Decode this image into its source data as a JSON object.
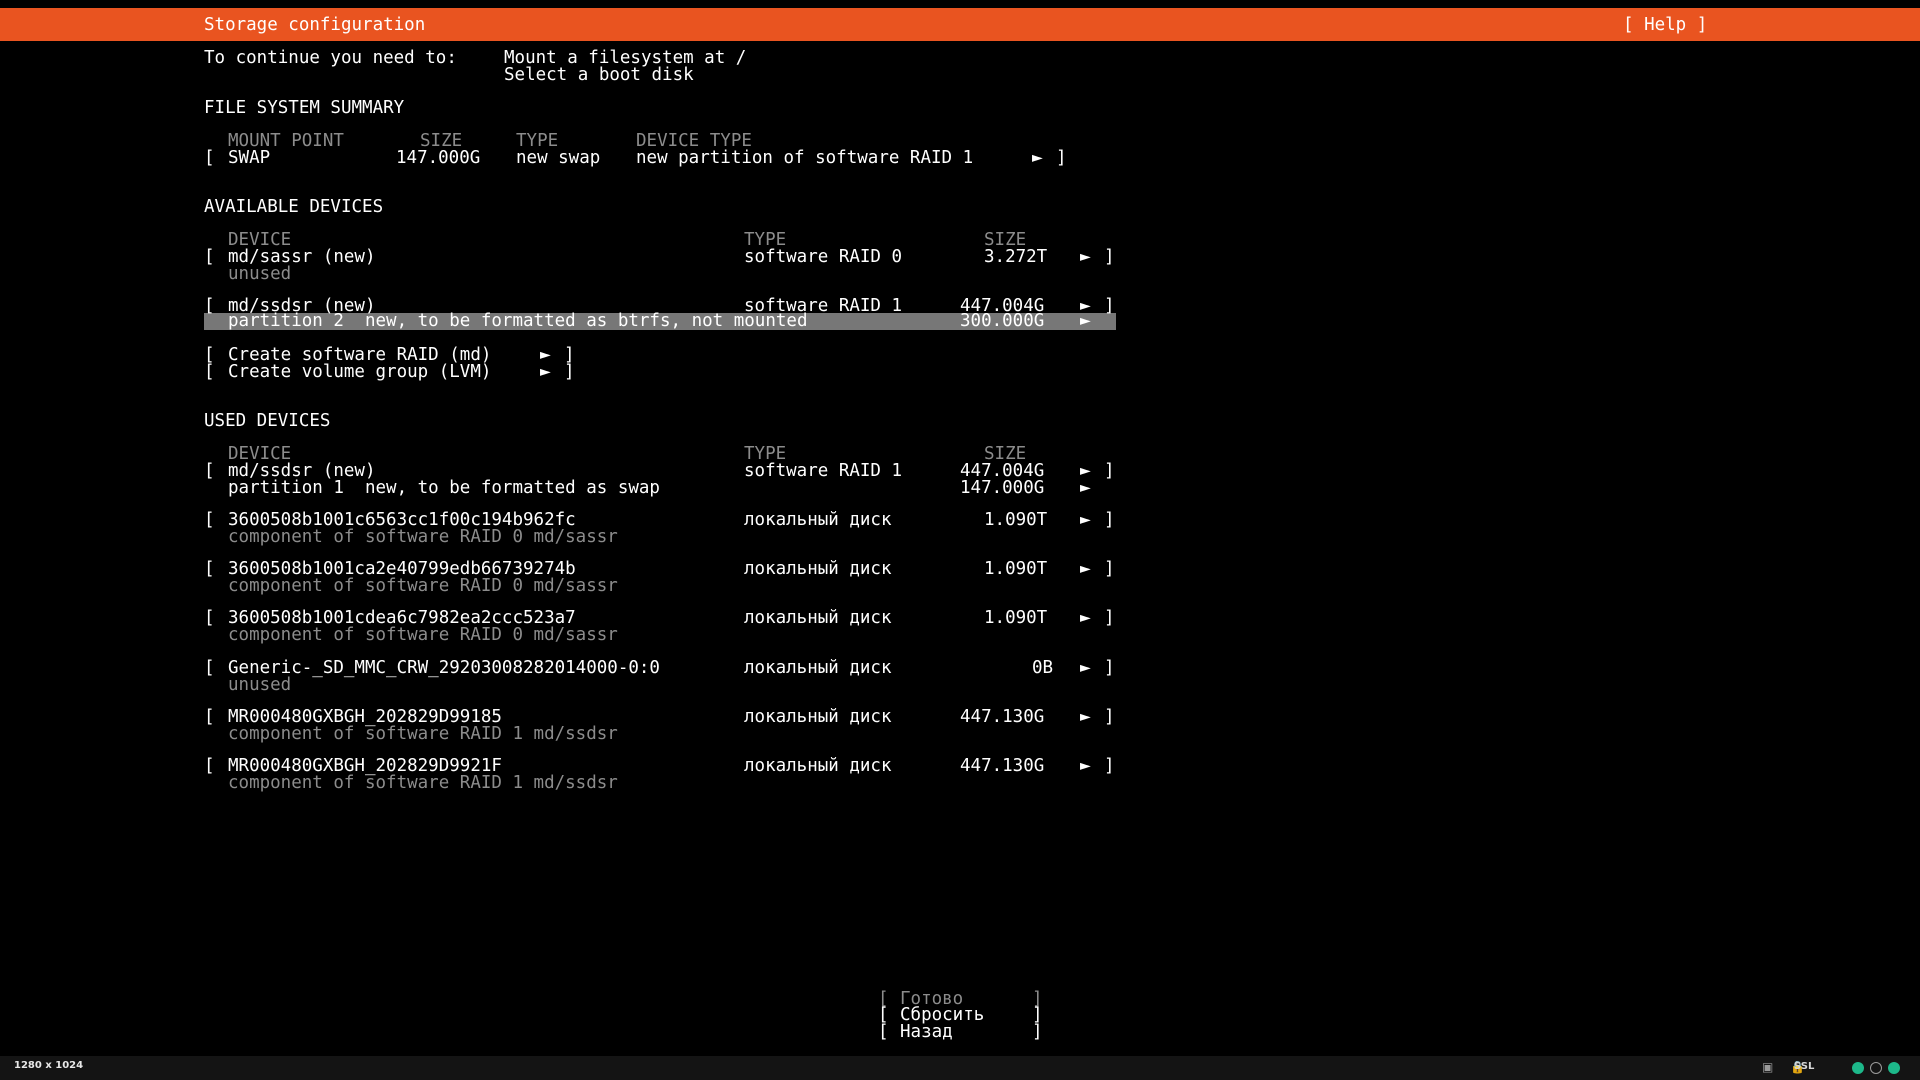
{
  "header": {
    "title": "Storage configuration",
    "help": "[ Help ]"
  },
  "instructions": {
    "prefix": "To continue you need to:",
    "items": [
      "Mount a filesystem at /",
      "Select a boot disk"
    ]
  },
  "fs_summary": {
    "title": "FILE SYSTEM SUMMARY",
    "columns": {
      "mount": "MOUNT POINT",
      "size": "SIZE",
      "type": "TYPE",
      "device_type": "DEVICE TYPE"
    },
    "rows": [
      {
        "mount": "SWAP",
        "size": "147.000G",
        "type": "new swap",
        "device_type": "new partition of software RAID 1"
      }
    ]
  },
  "available": {
    "title": "AVAILABLE DEVICES",
    "columns": {
      "device": "DEVICE",
      "type": "TYPE",
      "size": "SIZE"
    },
    "devices": [
      {
        "name": "md/sassr (new)",
        "type": "software RAID 0",
        "size": "3.272T",
        "sub": "unused"
      },
      {
        "name": "md/ssdsr (new)",
        "type": "software RAID 1",
        "size": "447.004G"
      }
    ],
    "partition": {
      "label": "partition 2  new, to be formatted as btrfs, not mounted",
      "size": "300.000G"
    },
    "actions": [
      "Create software RAID (md)",
      "Create volume group (LVM)"
    ]
  },
  "used": {
    "title": "USED DEVICES",
    "columns": {
      "device": "DEVICE",
      "type": "TYPE",
      "size": "SIZE"
    },
    "raid": {
      "name": "md/ssdsr (new)",
      "type": "software RAID 1",
      "size": "447.004G"
    },
    "raid_partition": {
      "label": "partition 1  new, to be formatted as swap",
      "size": "147.000G"
    },
    "disks": [
      {
        "name": "3600508b1001c6563cc1f00c194b962fc",
        "type": "локальный диск",
        "size": "1.090T",
        "sub": "component of software RAID 0 md/sassr"
      },
      {
        "name": "3600508b1001ca2e40799edb66739274b",
        "type": "локальный диск",
        "size": "1.090T",
        "sub": "component of software RAID 0 md/sassr"
      },
      {
        "name": "3600508b1001cdea6c7982ea2ccc523a7",
        "type": "локальный диск",
        "size": "1.090T",
        "sub": "component of software RAID 0 md/sassr"
      },
      {
        "name": "Generic-_SD_MMC_CRW_29203008282014000-0:0",
        "type": "локальный диск",
        "size": "0B",
        "sub": "unused"
      },
      {
        "name": "MR000480GXBGH_202829D99185",
        "type": "локальный диск",
        "size": "447.130G",
        "sub": "component of software RAID 1 md/ssdsr"
      },
      {
        "name": "MR000480GXBGH_202829D9921F",
        "type": "локальный диск",
        "size": "447.130G",
        "sub": "component of software RAID 1 md/ssdsr"
      }
    ]
  },
  "buttons": {
    "done": "Готово",
    "reset": "Сбросить",
    "back": "Назад"
  },
  "symbols": {
    "arrow": "►",
    "lbracket": "[",
    "rbracket": "]"
  },
  "statusbar": {
    "resolution": "1280 x 1024",
    "ssl": "SSL"
  },
  "colors": {
    "accent": "#e95420",
    "dim": "#8c8c8c",
    "ok": "#1db88a"
  }
}
